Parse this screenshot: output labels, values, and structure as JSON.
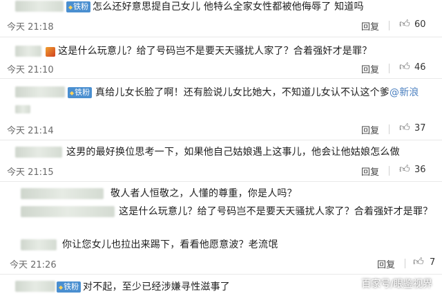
{
  "watermark": "百家号/眼鉴视界",
  "reply_label": "回复",
  "comments": [
    {
      "badge": "铁粉",
      "text": "怎么还好意思提自己女儿 他特么全家女性都被他侮辱了 知道吗",
      "time": "今天 21:18",
      "likes": "60"
    },
    {
      "badge": "",
      "text": "这是什么玩意儿？给了号码岂不是要天天骚扰人家了？合着强奸才是罪？",
      "time": "今天 21:10",
      "likes": "46"
    },
    {
      "badge": "铁粉",
      "text": "真给儿女长脸了啊！还有脸说儿女比她大，不知道儿女认不认这个爹",
      "mention": "@新浪",
      "time": "今天 21:14",
      "likes": "37"
    },
    {
      "badge": "",
      "text": "这男的最好换位思考一下，如果他自己姑娘遇上这事儿，他会让他姑娘怎么做",
      "time": "今天 21:15",
      "likes": "36"
    },
    {
      "badge": "",
      "text": "敬人者人恒敬之，人懂的尊重，你是人吗？",
      "time": "",
      "likes": ""
    },
    {
      "badge": "",
      "text": "这是什么玩意儿？给了号码岂不是要天天骚扰人家了？合着强奸才是罪？",
      "time": "",
      "likes": ""
    },
    {
      "badge": "",
      "text": "你让您女儿也拉出来踢下，看看他愿意波？老流氓",
      "time": "今天 21:26",
      "likes": "7"
    },
    {
      "badge": "铁粉",
      "text": "对不起，至少已经涉嫌寻性滋事了",
      "time": "",
      "likes": ""
    }
  ]
}
